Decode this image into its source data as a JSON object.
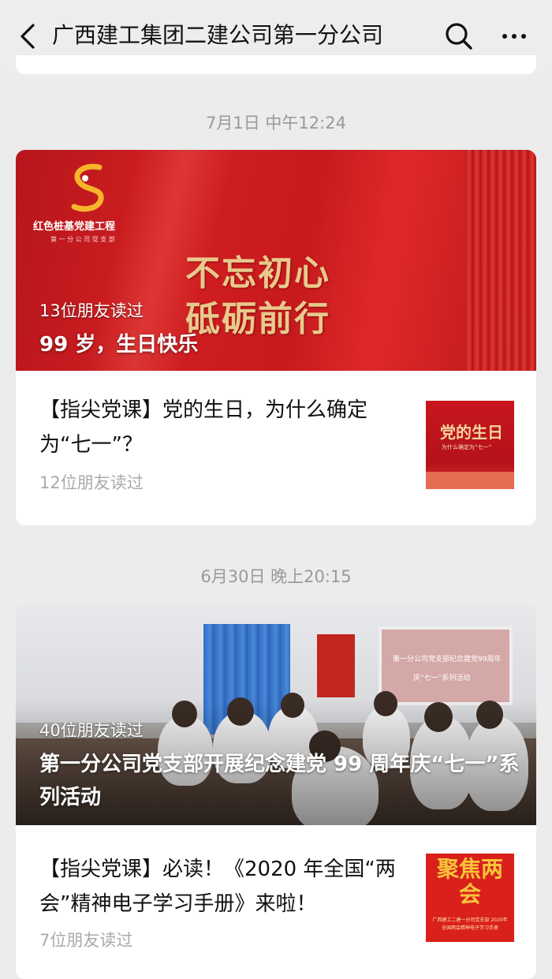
{
  "header": {
    "back_icon": "chevron-left-icon",
    "title": "广西建工集团二建公司第一分公司",
    "search_icon": "search-icon",
    "more_icon": "more-dots-icon"
  },
  "feed": [
    {
      "timestamp": "7月1日 中午12:24",
      "main": {
        "read_count": "13位朋友读过",
        "title": "99 岁，生日快乐",
        "cover_logo_text": "红色桩基党建工程",
        "cover_logo_sub": "第 一 分 公 司 党 支 部",
        "cover_slogan_line1": "不忘初心",
        "cover_slogan_line2": "砥砺前行"
      },
      "sub": {
        "title": "【指尖党课】党的生日，为什么确定为“七一”？",
        "read_count": "12位朋友读过",
        "thumb_text": "党的生日",
        "thumb_subtext": "为什么确定为“七一”"
      }
    },
    {
      "timestamp": "6月30日 晚上20:15",
      "main": {
        "read_count": "40位朋友读过",
        "title": "第一分公司党支部开展纪念建党 99 周年庆“七一”系列活动",
        "screen_line1": "第一分公司党支部纪念建党99周年",
        "screen_line2": "庆“七一”系列活动"
      },
      "sub": {
        "title": "【指尖党课】必读！《2020 年全国“两会”精神电子学习手册》来啦！",
        "read_count": "7位朋友读过",
        "thumb_text": "聚焦两会",
        "thumb_subtext": "广西建工二建一分司党支部 2020年全国两会精神电子学习手册"
      }
    }
  ],
  "colors": {
    "background": "#ececec",
    "card": "#ffffff",
    "timestamp": "#999999",
    "read_count": "#aaaaaa",
    "party_red": "#c8171d",
    "gold": "#e9c98c"
  }
}
